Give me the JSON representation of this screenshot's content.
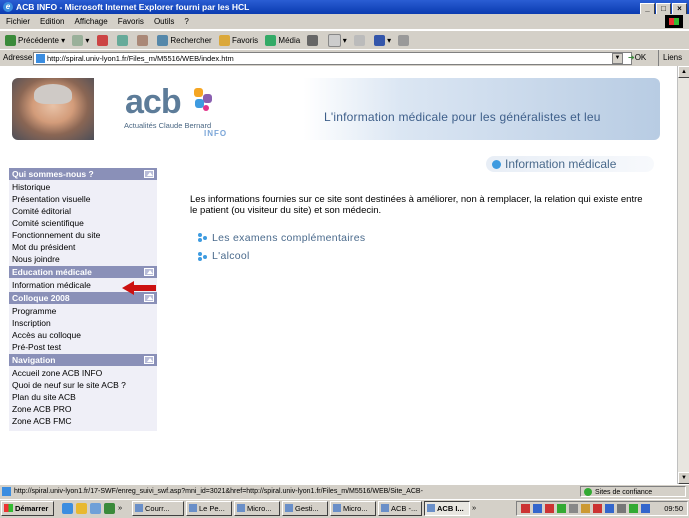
{
  "window": {
    "title": "ACB INFO - Microsoft Internet Explorer fourni par les HCL"
  },
  "menu": [
    "Fichier",
    "Edition",
    "Affichage",
    "Favoris",
    "Outils",
    "?"
  ],
  "toolbar": {
    "back": "Précédente",
    "search": "Rechercher",
    "favorites": "Favoris",
    "media": "Média"
  },
  "address": {
    "label": "Adresse",
    "url": "http://spiral.univ-lyon1.fr/Files_m/M5516/WEB/index.htm",
    "ok": "OK",
    "links": "Liens"
  },
  "banner": {
    "logo": "acb",
    "subtitle": "Actualités Claude Bernard",
    "info": "INFO",
    "tagline": "L'information médicale pour les généralistes et leu"
  },
  "nav": {
    "sections": [
      {
        "title": "Qui sommes-nous ?",
        "items": [
          "Historique",
          "Présentation visuelle",
          "Comité éditorial",
          "Comité scientifique",
          "Fonctionnement du site",
          "Mot du président",
          "Nous joindre"
        ]
      },
      {
        "title": "Education médicale",
        "items": [
          "Information médicale"
        ]
      },
      {
        "title": "Colloque 2008",
        "items": [
          "Programme",
          "Inscription",
          "Accès au colloque",
          "Pré-Post test"
        ]
      },
      {
        "title": "Navigation",
        "items": [
          "Accueil zone ACB INFO",
          "Quoi de neuf sur le site ACB ?",
          "Plan du site ACB",
          "Zone ACB PRO",
          "Zone ACB FMC"
        ]
      }
    ]
  },
  "main": {
    "heading": "Information médicale",
    "intro": "Les informations fournies sur ce site sont destinées à améliorer, non à remplacer, la relation qui existe entre le patient (ou visiteur du site) et son médecin.",
    "links": [
      "Les examens complémentaires",
      "L'alcool"
    ]
  },
  "status": {
    "url": "http://spiral.univ-lyon1.fr/17-SWF/enreg_suivi_swf.asp?mni_id=3021&href=http://spiral.univ-lyon1.fr/Files_m/M5516/WEB/Site_ACB-",
    "zone": "Sites de confiance"
  },
  "taskbar": {
    "start": "Démarrer",
    "tasks": [
      "Courr...",
      "Le Pe...",
      "Micro...",
      "Gesti...",
      "Micro...",
      "ACB -...",
      "ACB I..."
    ],
    "clock": "09:50"
  },
  "colors": {
    "titlebar": "#0a3bb0",
    "chrome": "#d4d0c8",
    "navhead": "#8a90b8",
    "navbody": "#efeff7",
    "link": "#4a6a8c",
    "arrow": "#cc1111"
  }
}
